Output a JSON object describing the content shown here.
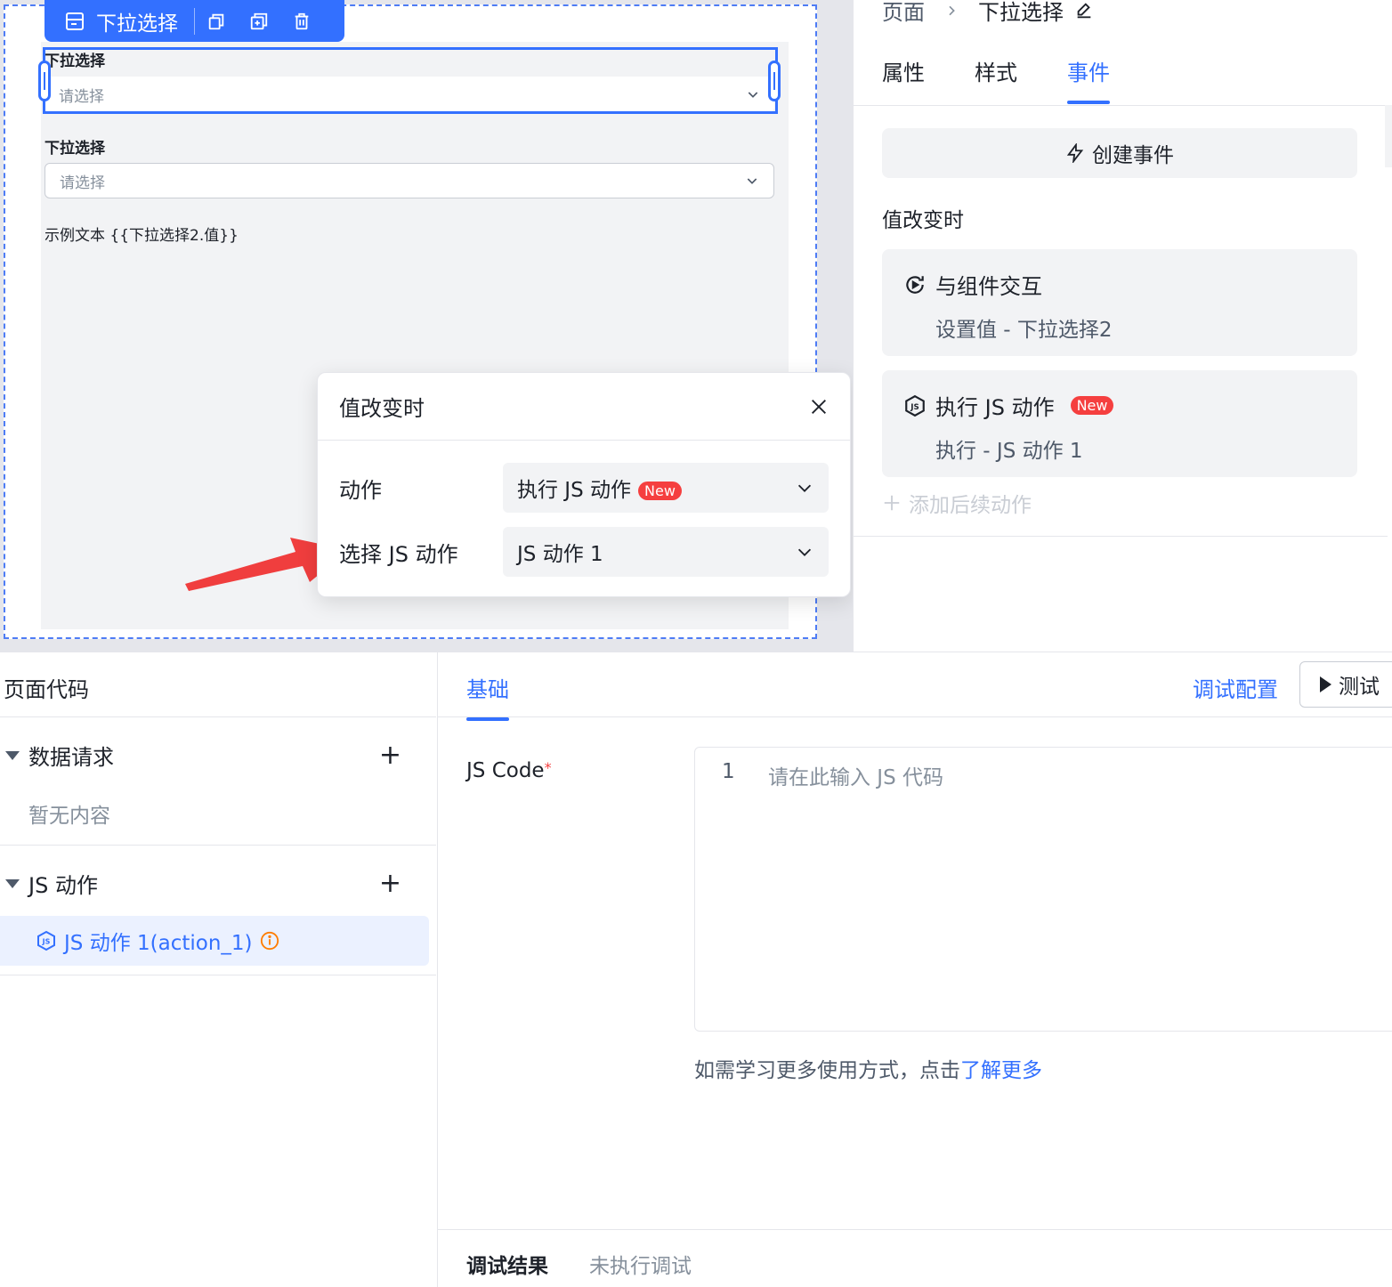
{
  "canvas": {
    "toolbar": {
      "component_name": "下拉选择",
      "icons": [
        "select-component-icon",
        "copy-icon",
        "duplicate-icon",
        "delete-icon"
      ]
    },
    "fields": [
      {
        "label": "下拉选择",
        "placeholder": "请选择"
      },
      {
        "label": "下拉选择",
        "placeholder": "请选择"
      }
    ],
    "sample_text": "示例文本 {{下拉选择2.值}}"
  },
  "popup": {
    "title": "值改变时",
    "rows": [
      {
        "label": "动作",
        "value": "执行 JS 动作",
        "badge": "New"
      },
      {
        "label": "选择 JS 动作",
        "value": "JS 动作 1"
      }
    ]
  },
  "right_panel": {
    "breadcrumb": {
      "page": "页面",
      "current": "下拉选择"
    },
    "tabs": [
      "属性",
      "样式",
      "事件"
    ],
    "active_tab": "事件",
    "create_event_label": "创建事件",
    "section_title": "值改变时",
    "actions": [
      {
        "title": "与组件交互",
        "desc": "设置值 - 下拉选择2"
      },
      {
        "title": "执行 JS 动作",
        "badge": "New",
        "desc": "执行 - JS 动作 1"
      }
    ],
    "add_action_label": "添加后续动作"
  },
  "page_code": {
    "title": "页面代码",
    "groups": [
      {
        "name": "数据请求",
        "empty_text": "暂无内容"
      },
      {
        "name": "JS 动作",
        "items": [
          "JS 动作 1(action_1)"
        ]
      }
    ]
  },
  "editor": {
    "tab": "基础",
    "debug_config_label": "调试配置",
    "test_label": "测试",
    "js_code_label": "JS Code",
    "required_mark": "*",
    "line_number": "1",
    "code_placeholder": "请在此输入 JS 代码",
    "help_prefix": "如需学习更多使用方式，点击",
    "help_link": "了解更多",
    "result_label": "调试结果",
    "result_value": "未执行调试"
  },
  "colors": {
    "accent": "#3370ff",
    "badge": "#f53f3f",
    "arrow": "#f03e3e",
    "info": "#ff7d00"
  }
}
